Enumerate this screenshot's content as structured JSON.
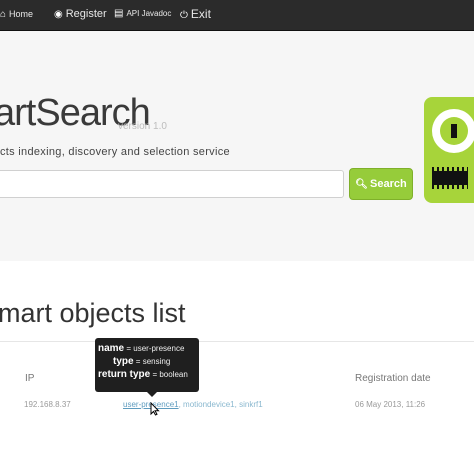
{
  "navbar": {
    "items": [
      {
        "label": "Home",
        "icon": "home-icon"
      },
      {
        "label": "Register",
        "icon": "user-circle-icon"
      },
      {
        "label": "API Javadoc",
        "icon": "document-icon"
      },
      {
        "label": "Exit",
        "icon": "exit-icon"
      }
    ]
  },
  "hero": {
    "brand": "artSearch",
    "version": "version 1.0",
    "tagline": "cts indexing, discovery and selection service",
    "search_value": "",
    "search_button": "Search"
  },
  "list": {
    "title": "mart objects list",
    "columns": {
      "ip": "IP",
      "date": "Registration date"
    },
    "rows": [
      {
        "ip": "192.168.8.37",
        "objects": [
          "user-presence1",
          "motiondevice1",
          "sinkrf1"
        ],
        "date": "06 May 2013, 11:26"
      }
    ]
  },
  "tooltip": {
    "name_key": "name",
    "name_value": "user-presence",
    "type_key": "type",
    "type_value": "sensing",
    "return_key": "return type",
    "return_value": "boolean"
  },
  "colors": {
    "navbar": "#2b2b2b",
    "accent": "#96cc3a",
    "logo": "#a7d43a",
    "link": "#8ab8cf"
  }
}
